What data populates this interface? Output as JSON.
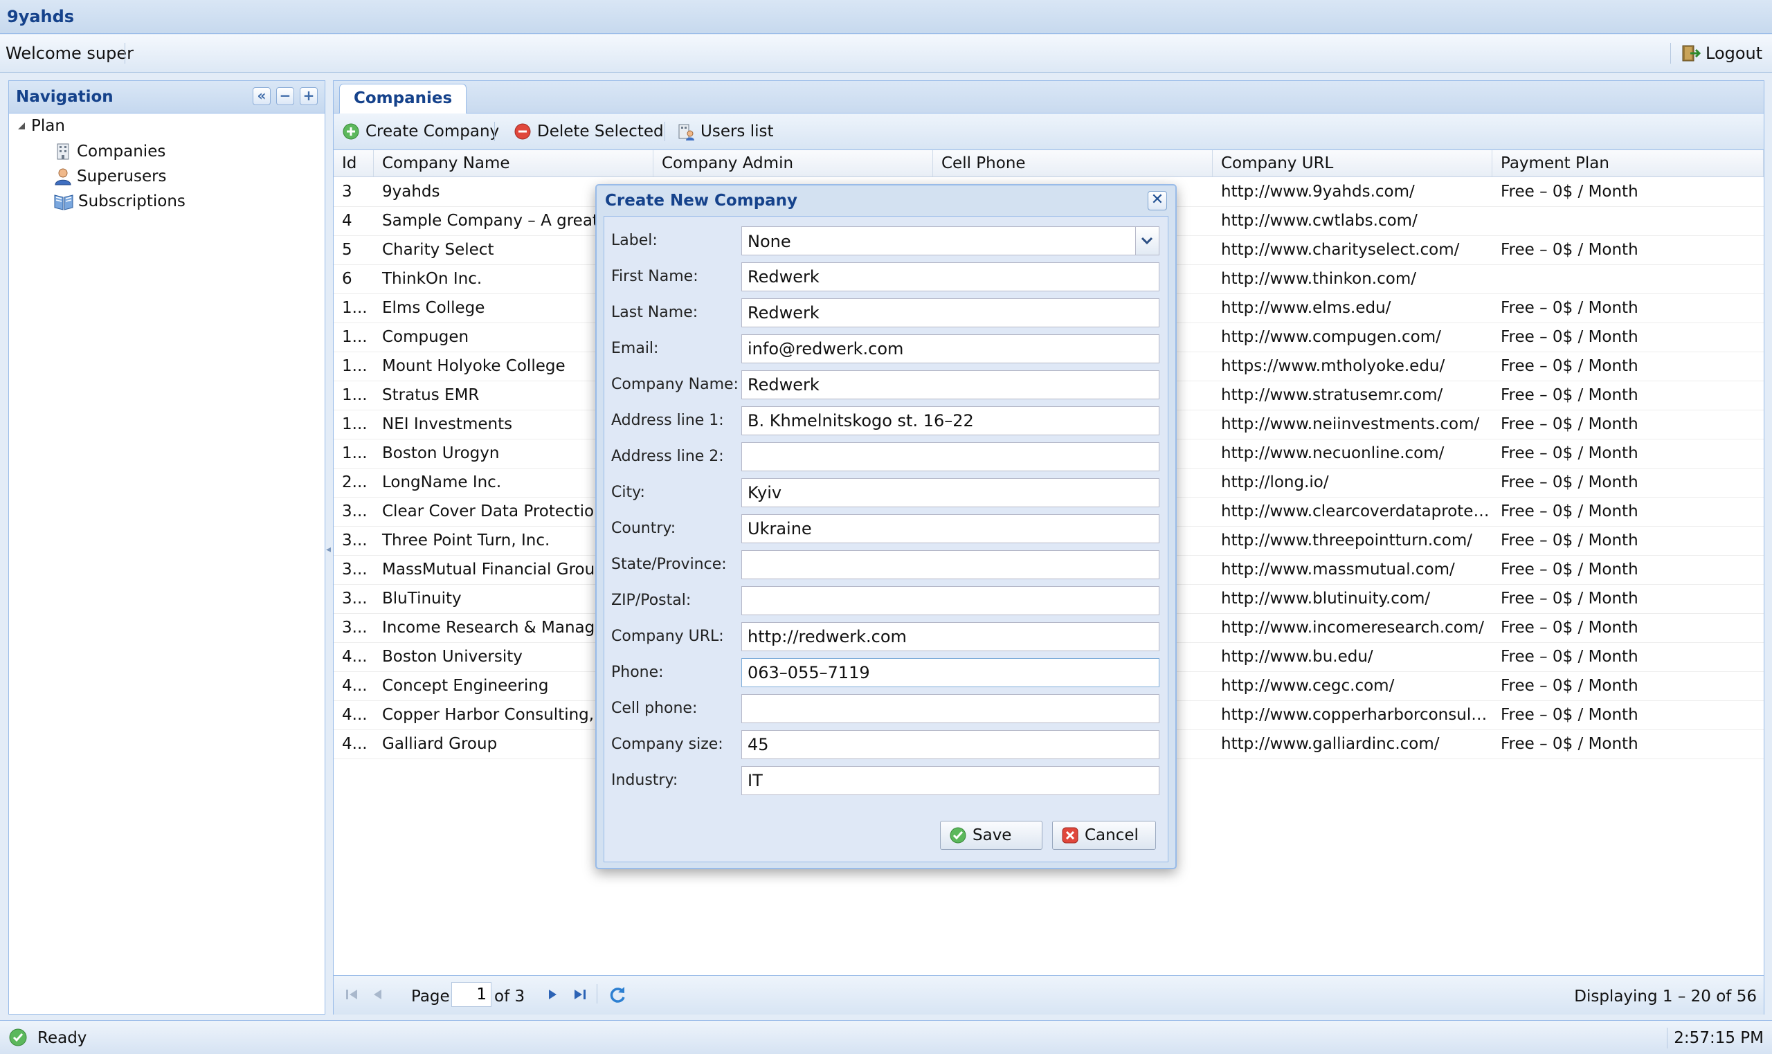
{
  "app": {
    "title": "9yahds"
  },
  "header": {
    "welcome": "Welcome super",
    "logout_label": "Logout"
  },
  "navigation": {
    "title": "Navigation",
    "tree": {
      "root": "Plan",
      "items": [
        {
          "label": "Companies",
          "icon": "building-icon"
        },
        {
          "label": "Superusers",
          "icon": "user-icon"
        },
        {
          "label": "Subscriptions",
          "icon": "book-icon"
        }
      ]
    }
  },
  "main": {
    "tab": "Companies",
    "toolbar": {
      "create": "Create Company",
      "delete": "Delete Selected",
      "users": "Users list"
    },
    "columns": [
      "Id",
      "Company Name",
      "Company Admin",
      "Cell Phone",
      "Company URL",
      "Payment Plan"
    ],
    "rows": [
      {
        "id": "3",
        "name": "9yahds",
        "url": "http://www.9yahds.com/",
        "plan": "Free – 0$ / Month"
      },
      {
        "id": "4",
        "name": "Sample Company – A great place to work",
        "url": "http://www.cwtlabs.com/",
        "plan": ""
      },
      {
        "id": "5",
        "name": "Charity Select",
        "url": "http://www.charityselect.com/",
        "plan": "Free – 0$ / Month"
      },
      {
        "id": "6",
        "name": "ThinkOn Inc.",
        "url": "http://www.thinkon.com/",
        "plan": ""
      },
      {
        "id": "1...",
        "name": "Elms College",
        "url": "http://www.elms.edu/",
        "plan": "Free – 0$ / Month"
      },
      {
        "id": "1...",
        "name": "Compugen",
        "url": "http://www.compugen.com/",
        "plan": "Free – 0$ / Month"
      },
      {
        "id": "1...",
        "name": "Mount Holyoke College",
        "url": "https://www.mtholyoke.edu/",
        "plan": "Free – 0$ / Month"
      },
      {
        "id": "1...",
        "name": "Stratus EMR",
        "url": "http://www.stratusemr.com/",
        "plan": "Free – 0$ / Month"
      },
      {
        "id": "1...",
        "name": "NEI Investments",
        "url": "http://www.neiinvestments.com/",
        "plan": "Free – 0$ / Month"
      },
      {
        "id": "1...",
        "name": "Boston Urogyn",
        "url": "http://www.necuonline.com/",
        "plan": "Free – 0$ / Month"
      },
      {
        "id": "2...",
        "name": "LongName Inc.",
        "url": "http://long.io/",
        "plan": "Free – 0$ / Month"
      },
      {
        "id": "3...",
        "name": "Clear Cover Data Protection Co",
        "url": "http://www.clearcoverdataprotection.com/",
        "plan": "Free – 0$ / Month"
      },
      {
        "id": "3...",
        "name": "Three Point Turn, Inc.",
        "url": "http://www.threepointturn.com/",
        "plan": "Free – 0$ / Month"
      },
      {
        "id": "3...",
        "name": "MassMutual Financial Group",
        "url": "http://www.massmutual.com/",
        "plan": "Free – 0$ / Month"
      },
      {
        "id": "3...",
        "name": "BluTinuity",
        "url": "http://www.blutinuity.com/",
        "plan": "Free – 0$ / Month"
      },
      {
        "id": "3...",
        "name": "Income Research & Management",
        "url": "http://www.incomeresearch.com/",
        "plan": "Free – 0$ / Month"
      },
      {
        "id": "4...",
        "name": "Boston University",
        "url": "http://www.bu.edu/",
        "plan": "Free – 0$ / Month"
      },
      {
        "id": "4...",
        "name": "Concept Engineering",
        "url": "http://www.cegc.com/",
        "plan": "Free – 0$ / Month"
      },
      {
        "id": "4...",
        "name": "Copper Harbor Consulting, Inc.",
        "url": "http://www.copperharborconsulting.com/",
        "plan": "Free – 0$ / Month"
      },
      {
        "id": "4...",
        "name": "Galliard Group",
        "url": "http://www.galliardinc.com/",
        "plan": "Free – 0$ / Month"
      }
    ],
    "paging": {
      "page_label": "Page",
      "current_page": "1",
      "of_label": "of 3",
      "displaying": "Displaying 1 – 20 of 56"
    }
  },
  "dialog": {
    "title": "Create New Company",
    "label_field": {
      "label": "Label:",
      "value": "None"
    },
    "fields": [
      {
        "name": "first-name",
        "label": "First Name:",
        "value": "Redwerk"
      },
      {
        "name": "last-name",
        "label": "Last Name:",
        "value": "Redwerk"
      },
      {
        "name": "email",
        "label": "Email:",
        "value": "info@redwerk.com"
      },
      {
        "name": "company-name",
        "label": "Company Name:",
        "value": "Redwerk"
      },
      {
        "name": "address-line-1",
        "label": "Address line 1:",
        "value": "B. Khmelnitskogo st. 16–22"
      },
      {
        "name": "address-line-2",
        "label": "Address line 2:",
        "value": ""
      },
      {
        "name": "city",
        "label": "City:",
        "value": "Kyiv"
      },
      {
        "name": "country",
        "label": "Country:",
        "value": "Ukraine"
      },
      {
        "name": "state-province",
        "label": "State/Province:",
        "value": ""
      },
      {
        "name": "zip-postal",
        "label": "ZIP/Postal:",
        "value": ""
      },
      {
        "name": "company-url",
        "label": "Company URL:",
        "value": "http://redwerk.com"
      },
      {
        "name": "phone",
        "label": "Phone:",
        "value": "063–055–7119"
      },
      {
        "name": "cell-phone",
        "label": "Cell phone:",
        "value": ""
      },
      {
        "name": "company-size",
        "label": "Company size:",
        "value": "45"
      },
      {
        "name": "industry",
        "label": "Industry:",
        "value": "IT"
      }
    ],
    "save_label": "Save",
    "cancel_label": "Cancel"
  },
  "status": {
    "text": "Ready",
    "time": "2:57:15 PM"
  },
  "colors": {
    "header_blue": "#15428b",
    "border_blue": "#99bbe8",
    "panel_bg": "#dfe8f6"
  }
}
